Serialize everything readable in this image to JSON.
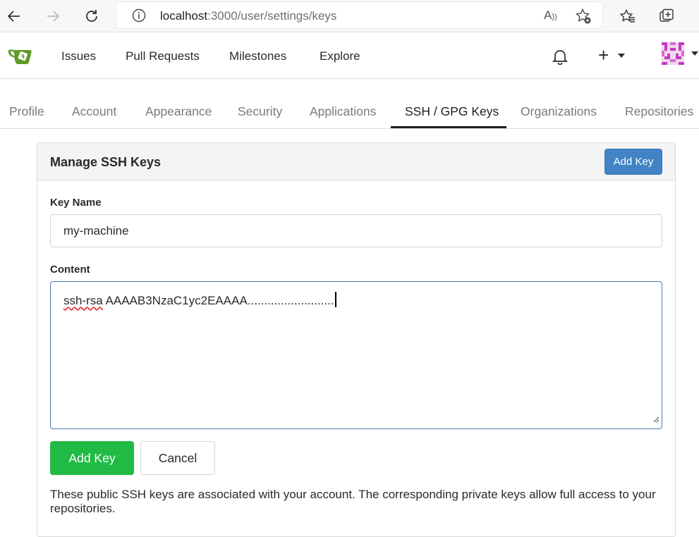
{
  "browser": {
    "url_host": "localhost",
    "url_path": ":3000/user/settings/keys"
  },
  "nav": {
    "items": [
      "Issues",
      "Pull Requests",
      "Milestones",
      "Explore"
    ],
    "plus_label": "+"
  },
  "settings_tabs": [
    "Profile",
    "Account",
    "Appearance",
    "Security",
    "Applications",
    "SSH / GPG Keys",
    "Organizations",
    "Repositories"
  ],
  "active_tab": "SSH / GPG Keys",
  "panel": {
    "title": "Manage SSH Keys",
    "add_key_top": "Add Key",
    "key_name_label": "Key Name",
    "key_name_value": "my-machine",
    "content_label": "Content",
    "content_prefix": "ssh-rsa",
    "content_rest": " AAAAB3NzaC1yc2EAAAA..........................",
    "submit": "Add Key",
    "cancel": "Cancel",
    "help": "These public SSH keys are associated with your account. The corresponding private keys allow full access to your repositories."
  },
  "colors": {
    "primary_blue": "#4183c4",
    "green": "#21ba45",
    "gitea_green": "#609926"
  }
}
